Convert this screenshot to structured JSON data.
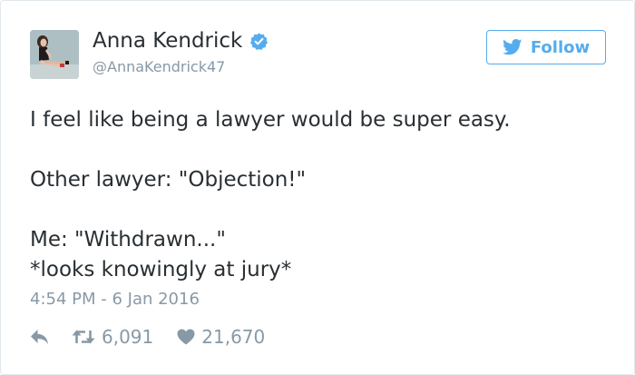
{
  "user": {
    "name": "Anna Kendrick",
    "handle": "@AnnaKendrick47",
    "verified": true
  },
  "follow_button": {
    "label": "Follow",
    "icon": "twitter-bird-icon"
  },
  "tweet": {
    "lines": [
      "I feel like being a lawyer would be super easy.",
      "Other lawyer: \"Objection!\"",
      "Me: \"Withdrawn...\"",
      "*looks knowingly at jury*"
    ],
    "timestamp": "4:54 PM - 6 Jan 2016"
  },
  "actions": {
    "reply_icon": "reply-icon",
    "retweet_icon": "retweet-icon",
    "retweet_count": "6,091",
    "like_icon": "heart-icon",
    "like_count": "21,670"
  },
  "colors": {
    "accent": "#55acee",
    "text": "#292f33",
    "muted": "#8899a6",
    "border": "#e1e8ed"
  }
}
